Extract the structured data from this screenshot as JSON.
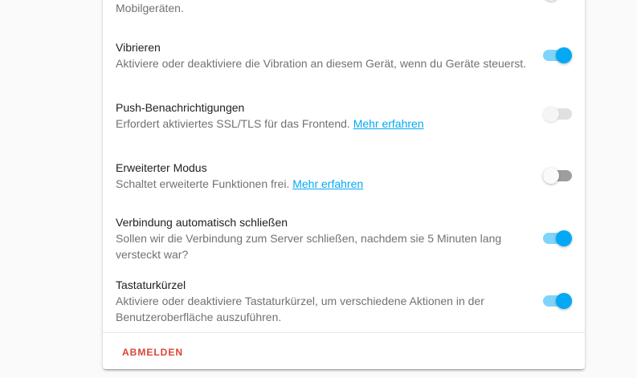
{
  "colors": {
    "accent": "#03a9f4",
    "danger": "#db4437"
  },
  "settings": [
    {
      "title": "",
      "description": "Mobilgeräten.",
      "link": "",
      "toggle": "partial"
    },
    {
      "title": "Vibrieren",
      "description": "Aktiviere oder deaktiviere die Vibration an diesem Gerät, wenn du Geräte steuerst.",
      "link": "",
      "toggle": "on"
    },
    {
      "title": "Push-Benachrichtigungen",
      "description": "Erfordert aktiviertes SSL/TLS für das Frontend.",
      "link": "Mehr erfahren",
      "toggle": "disabled"
    },
    {
      "title": "Erweiterter Modus",
      "description": "Schaltet erweiterte Funktionen frei.",
      "link": "Mehr erfahren",
      "toggle": "off"
    },
    {
      "title": "Verbindung automatisch schließen",
      "description": "Sollen wir die Verbindung zum Server schließen, nachdem sie 5 Minuten lang versteckt war?",
      "link": "",
      "toggle": "on"
    },
    {
      "title": "Tastaturkürzel",
      "description": "Aktiviere oder deaktiviere Tastaturkürzel, um verschiedene Aktionen in der Benutzeroberfläche auszuführen.",
      "link": "",
      "toggle": "on"
    }
  ],
  "footer": {
    "logout_label": "ABMELDEN"
  }
}
